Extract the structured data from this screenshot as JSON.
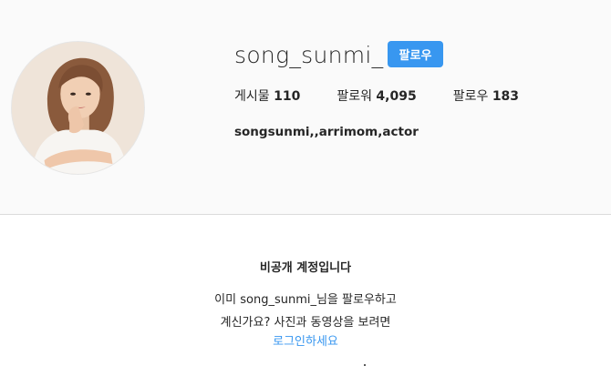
{
  "profile": {
    "username": "song_sunmi_",
    "follow_label": "팔로우",
    "bio": "songsunmi,,arrimom,actor",
    "avatar_icon": "profile-photo",
    "stats": [
      {
        "label": "게시물",
        "value": "110"
      },
      {
        "label": "팔로워",
        "value": "4,095"
      },
      {
        "label": "팔로우",
        "value": "183"
      }
    ]
  },
  "private_notice": {
    "title": "비공개 계정입니다",
    "line1": "이미 song_sunmi_님을 팔로우하고",
    "line2": "계신가요? 사진과 동영상을 보려면",
    "login_link": "로그인하세요"
  },
  "colors": {
    "accent": "#3897f0",
    "header_bg": "#fafafa",
    "text": "#262626",
    "border": "#dbdbdb"
  }
}
